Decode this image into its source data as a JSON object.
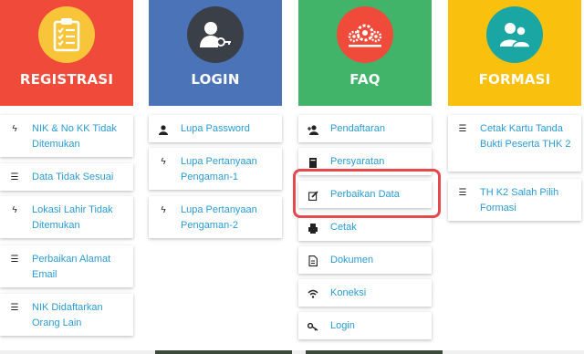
{
  "colors": {
    "registrasi": "#ef4a3a",
    "login": "#4b73b8",
    "faq": "#41b46a",
    "formasi": "#f9c00d",
    "link": "#2a9bd3",
    "highlight": "#e5484d"
  },
  "columns": [
    {
      "title": "REGISTRASI",
      "icon": "clipboard-checklist-icon",
      "items": [
        {
          "icon": "bolt-icon",
          "label": "NIK & No KK Tidak Ditemukan"
        },
        {
          "icon": "list-lines-icon",
          "label": "Data Tidak Sesuai"
        },
        {
          "icon": "bolt-icon",
          "label": "Lokasi Lahir Tidak Ditemukan"
        },
        {
          "icon": "list-lines-icon",
          "label": "Perbaikan Alamat Email"
        },
        {
          "icon": "list-lines-icon",
          "label": "NIK Didaftarkan Orang Lain"
        }
      ]
    },
    {
      "title": "LOGIN",
      "icon": "user-key-icon",
      "items": [
        {
          "icon": "user-icon",
          "label": "Lupa Password"
        },
        {
          "icon": "bolt-icon",
          "label": "Lupa Pertanyaan Pengaman-1"
        },
        {
          "icon": "bolt-icon",
          "label": "Lupa Pertanyaan Pengaman-2"
        }
      ]
    },
    {
      "title": "FAQ",
      "icon": "gears-icon",
      "items": [
        {
          "icon": "user-plus-icon",
          "label": "Pendaftaran"
        },
        {
          "icon": "book-icon",
          "label": "Persyaratan"
        },
        {
          "icon": "edit-icon",
          "label": "Perbaikan Data"
        },
        {
          "icon": "print-icon",
          "label": "Cetak"
        },
        {
          "icon": "document-icon",
          "label": "Dokumen"
        },
        {
          "icon": "wifi-icon",
          "label": "Koneksi"
        },
        {
          "icon": "key-icon",
          "label": "Login"
        }
      ]
    },
    {
      "title": "FORMASI",
      "icon": "users-icon",
      "items": [
        {
          "icon": "list-lines-icon",
          "label": "Cetak Kartu Tanda Bukti Peserta THK 2"
        },
        {
          "icon": "list-lines-icon",
          "label": "TH K2 Salah Pilih Formasi"
        }
      ]
    }
  ]
}
